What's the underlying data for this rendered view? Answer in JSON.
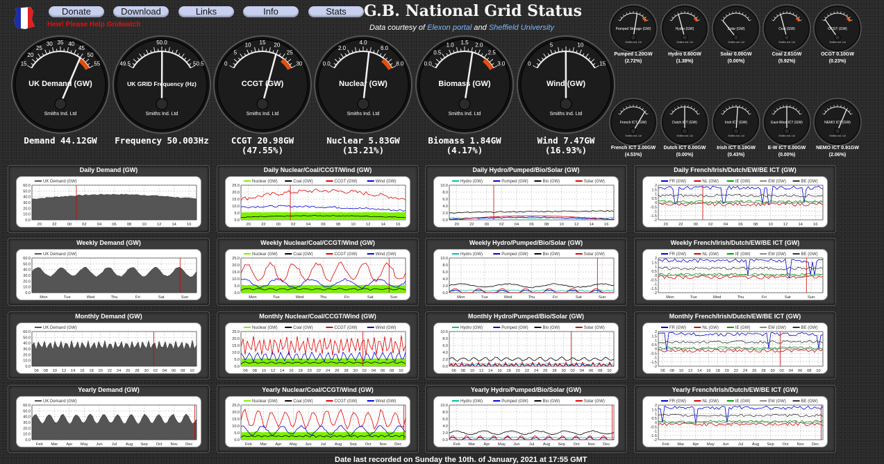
{
  "nav": [
    "Donate",
    "Download",
    "Links",
    "Info",
    "Stats"
  ],
  "help_text": "Hew! Please Help Gridwatch",
  "site_title": "G.B. National Grid Status",
  "credit": {
    "prefix": "Data courtesy of ",
    "elexon": "Elexon portal",
    "mid": " and ",
    "sheffield": "Sheffield University"
  },
  "gauge_brand": "Smiths Ind. Ltd",
  "colors": {
    "nuclear": "#7ef000",
    "coal": "#000000",
    "ccgt": "#e00000",
    "wind": "#0000e0",
    "hydro": "#00c0a0",
    "pumped": "#0000e0",
    "bio": "#000000",
    "solar": "#e00000",
    "fr": "#0000d0",
    "nl": "#d00000",
    "ie": "#00a000",
    "ew": "#888888",
    "be": "#333333",
    "demand_fill": "#555555",
    "marker": "#d00000"
  },
  "big_gauges": [
    {
      "label": "UK Demand (GW)",
      "min": 0,
      "max": 55,
      "ticks": [
        "15",
        "20",
        "25",
        "30",
        "35",
        "40",
        "45",
        "50",
        "55"
      ],
      "value": 44.12,
      "caption1": "Demand 44.12GW",
      "caption2": "",
      "redzone": true
    },
    {
      "label": "UK GRID Frequency (Hz)",
      "min": 49.5,
      "max": 50.5,
      "ticks": [
        "49.5",
        "50.0",
        "50.5"
      ],
      "value": 50.003,
      "caption1": "Frequency 50.003Hz",
      "caption2": "",
      "redzone": false
    },
    {
      "label": "CCGT (GW)",
      "min": 0,
      "max": 30,
      "ticks": [
        "0",
        "5",
        "10",
        "15",
        "20",
        "25",
        "30"
      ],
      "value": 20.98,
      "caption1": "CCGT 20.98GW",
      "caption2": "(47.55%)",
      "redzone": true
    },
    {
      "label": "Nuclear (GW)",
      "min": 0,
      "max": 10,
      "ticks": [
        "0.0",
        "2.0",
        "4.0",
        "6.0",
        "8.0"
      ],
      "value": 5.83,
      "caption1": "Nuclear 5.83GW",
      "caption2": "(13.21%)",
      "redzone": true
    },
    {
      "label": "Biomass (GW)",
      "min": 0,
      "max": 3,
      "ticks": [
        "0.0",
        "0.5",
        "1.0",
        "1.5",
        "2.0",
        "2.5",
        "3.0"
      ],
      "value": 1.84,
      "caption1": "Biomass 1.84GW",
      "caption2": "(4.17%)",
      "redzone": true
    },
    {
      "label": "Wind (GW)",
      "min": 0,
      "max": 15,
      "ticks": [
        "0",
        "5",
        "10",
        "15"
      ],
      "value": 7.47,
      "caption1": "Wind 7.47GW",
      "caption2": "(16.93%)",
      "redzone": false
    }
  ],
  "small_gauges": [
    {
      "label": "Pumped Storage (GW)",
      "value_frac": 0.62,
      "caption1": "Pumped 1.20GW",
      "caption2": "(2.72%)"
    },
    {
      "label": "Hydro (GW)",
      "value_frac": 0.3,
      "caption1": "Hydro 0.60GW",
      "caption2": "(1.38%)"
    },
    {
      "label": "Solar (GW)",
      "value_frac": 0.0,
      "caption1": "Solar 0.00GW",
      "caption2": "(0.00%)"
    },
    {
      "label": "Coal (GW)",
      "value_frac": 0.3,
      "caption1": "Coal 2.61GW",
      "caption2": "(5.92%)"
    },
    {
      "label": "OCGT (GW)",
      "value_frac": 0.05,
      "caption1": "OCGT 0.10GW",
      "caption2": "(0.23%)"
    },
    {
      "label": "French ICT (GW)",
      "value_frac": 0.9,
      "caption1": "French ICT 2.00GW",
      "caption2": "(4.53%)"
    },
    {
      "label": "Dutch ICT (GW)",
      "value_frac": 0.5,
      "caption1": "Dutch ICT 0.00GW",
      "caption2": "(0.00%)"
    },
    {
      "label": "Irish ICT (GW)",
      "value_frac": 0.55,
      "caption1": "Irish ICT 0.19GW",
      "caption2": "(0.43%)"
    },
    {
      "label": "East-West ICT (GW)",
      "value_frac": 0.5,
      "caption1": "E-W ICT 0.00GW",
      "caption2": "(0.00%)"
    },
    {
      "label": "NEMO ICT (GW)",
      "value_frac": 0.8,
      "caption1": "NEMO ICT 0.91GW",
      "caption2": "(2.06%)"
    }
  ],
  "chart_data": [
    {
      "id": "daily-demand",
      "title": "Daily Demand (GW)",
      "type": "area",
      "kind": "demand",
      "ylim": [
        0,
        60
      ],
      "yticks": [
        "0.0",
        "10.0",
        "20.0",
        "30.0",
        "40.0",
        "50.0",
        "60.0"
      ],
      "xlabels": [
        "20",
        "22",
        "00",
        "02",
        "04",
        "06",
        "08",
        "10",
        "12",
        "14",
        "16"
      ],
      "legend": [
        "UK Demand (GW)"
      ],
      "marker": 0.27
    },
    {
      "id": "daily-gen",
      "title": "Daily Nuclear/Coal/CCGT/Wind (GW)",
      "type": "line",
      "kind": "gen",
      "ylim": [
        0,
        25
      ],
      "yticks": [
        "0.0",
        "5.0",
        "10.0",
        "15.0",
        "20.0",
        "25.0"
      ],
      "xlabels": [
        "20",
        "22",
        "00",
        "02",
        "04",
        "06",
        "08",
        "10",
        "12",
        "14",
        "16"
      ],
      "legend": [
        "Nuclear (GW)",
        "Coal (GW)",
        "CCGT (GW)",
        "Wind (GW)"
      ],
      "marker": 0.3
    },
    {
      "id": "daily-hydro",
      "title": "Daily Hydro/Pumped/Bio/Solar (GW)",
      "type": "line",
      "kind": "hydro",
      "ylim": [
        0,
        10
      ],
      "yticks": [
        "0.0",
        "2.0",
        "4.0",
        "6.0",
        "8.0",
        "10.0"
      ],
      "xlabels": [
        "20",
        "22",
        "00",
        "02",
        "04",
        "06",
        "08",
        "10",
        "12",
        "14",
        "16"
      ],
      "legend": [
        "Hydro (GW)",
        "Pumped (GW)",
        "Bio (GW)",
        "Solar (GW)"
      ],
      "marker": 0.27
    },
    {
      "id": "daily-ict",
      "title": "Daily French/Irish/Dutch/EW/BE ICT (GW)",
      "type": "line",
      "kind": "ict",
      "ylim": [
        -2,
        2
      ],
      "yticks": [
        "-2",
        "-1.5",
        "-1",
        "-0.5",
        "0",
        "0.5",
        "1",
        "1.5",
        "2"
      ],
      "xlabels": [
        "20",
        "22",
        "00",
        "02",
        "04",
        "06",
        "08",
        "10",
        "12",
        "14",
        "16"
      ],
      "legend": [
        "FR (GW)",
        "NL (GW)",
        "IE (GW)",
        "EW (GW)",
        "BE (GW)"
      ],
      "marker": 0.27
    },
    {
      "id": "weekly-demand",
      "title": "Weekly Demand (GW)",
      "type": "area",
      "kind": "demand",
      "ylim": [
        0,
        60
      ],
      "yticks": [
        "0.0",
        "10.0",
        "20.0",
        "30.0",
        "40.0",
        "50.0",
        "60.0"
      ],
      "xlabels": [
        "Mon",
        "Tue",
        "Wed",
        "Thu",
        "Fri",
        "Sat",
        "Sun"
      ],
      "legend": [
        "UK Demand (GW)"
      ],
      "marker": 0.9
    },
    {
      "id": "weekly-gen",
      "title": "Weekly Nuclear/Coal/CCGT/Wind (GW)",
      "type": "line",
      "kind": "gen",
      "ylim": [
        0,
        25
      ],
      "yticks": [
        "0.0",
        "5.0",
        "10.0",
        "15.0",
        "20.0",
        "25.0"
      ],
      "xlabels": [
        "Mon",
        "Tue",
        "Wed",
        "Thu",
        "Fri",
        "Sat",
        "Sun"
      ],
      "legend": [
        "Nuclear (GW)",
        "Coal (GW)",
        "CCGT (GW)",
        "Wind (GW)"
      ],
      "marker": 0.9
    },
    {
      "id": "weekly-hydro",
      "title": "Weekly Hydro/Pumped/Bio/Solar (GW)",
      "type": "line",
      "kind": "hydro",
      "ylim": [
        0,
        10
      ],
      "yticks": [
        "0.0",
        "2.0",
        "4.0",
        "6.0",
        "8.0",
        "10.0"
      ],
      "xlabels": [
        "Mon",
        "Tue",
        "Wed",
        "Thu",
        "Fri",
        "Sat",
        "Sun"
      ],
      "legend": [
        "Hydro (GW)",
        "Pumped (GW)",
        "Bio (GW)",
        "Solar (GW)"
      ],
      "marker": 0.9
    },
    {
      "id": "weekly-ict",
      "title": "Weekly French/Irish/Dutch/EW/BE ICT (GW)",
      "type": "line",
      "kind": "ict",
      "ylim": [
        -2,
        2
      ],
      "yticks": [
        "-2",
        "-1.5",
        "-1",
        "-0.5",
        "0",
        "0.5",
        "1",
        "1.5",
        "2"
      ],
      "xlabels": [
        "Mon",
        "Tue",
        "Wed",
        "Thu",
        "Fri",
        "Sat",
        "Sun"
      ],
      "legend": [
        "FR (GW)",
        "NL (GW)",
        "IE (GW)",
        "EW (GW)",
        "BE (GW)"
      ],
      "marker": 0.9
    },
    {
      "id": "monthly-demand",
      "title": "Monthly Demand (GW)",
      "type": "area",
      "kind": "demand",
      "ylim": [
        0,
        60
      ],
      "yticks": [
        "0.0",
        "10.0",
        "20.0",
        "30.0",
        "40.0",
        "50.0",
        "60.0"
      ],
      "xlabels": [
        "06",
        "08",
        "10",
        "12",
        "14",
        "16",
        "18",
        "20",
        "22",
        "24",
        "26",
        "28",
        "30",
        "02",
        "04",
        "06",
        "08",
        "10"
      ],
      "legend": [
        "UK Demand (GW)"
      ],
      "marker": 0.74
    },
    {
      "id": "monthly-gen",
      "title": "Monthly Nuclear/Coal/CCGT/Wind (GW)",
      "type": "line",
      "kind": "gen",
      "ylim": [
        0,
        25
      ],
      "yticks": [
        "0.0",
        "5.0",
        "10.0",
        "15.0",
        "20.0",
        "25.0"
      ],
      "xlabels": [
        "06",
        "08",
        "10",
        "12",
        "14",
        "16",
        "18",
        "20",
        "22",
        "24",
        "26",
        "28",
        "30",
        "02",
        "04",
        "06",
        "08",
        "10"
      ],
      "legend": [
        "Nuclear (GW)",
        "Coal (GW)",
        "CCGT (GW)",
        "Wind (GW)"
      ],
      "marker": 0.74
    },
    {
      "id": "monthly-hydro",
      "title": "Monthly Hydro/Pumped/Bio/Solar (GW)",
      "type": "line",
      "kind": "hydro",
      "ylim": [
        0,
        10
      ],
      "yticks": [
        "0.0",
        "2.0",
        "4.0",
        "6.0",
        "8.0",
        "10.0"
      ],
      "xlabels": [
        "06",
        "08",
        "10",
        "12",
        "14",
        "16",
        "18",
        "20",
        "22",
        "24",
        "26",
        "28",
        "30",
        "02",
        "04",
        "06",
        "08",
        "10"
      ],
      "legend": [
        "Hydro (GW)",
        "Pumped (GW)",
        "Bio (GW)",
        "Solar (GW)"
      ],
      "marker": 0.74
    },
    {
      "id": "monthly-ict",
      "title": "Monthly French/Irish/Dutch/EW/BE ICT (GW)",
      "type": "line",
      "kind": "ict",
      "ylim": [
        -2,
        2
      ],
      "yticks": [
        "-2",
        "-1.5",
        "-1",
        "-0.5",
        "0",
        "0.5",
        "1",
        "1.5",
        "2"
      ],
      "xlabels": [
        "06",
        "08",
        "10",
        "12",
        "14",
        "16",
        "18",
        "20",
        "22",
        "24",
        "26",
        "28",
        "30",
        "02",
        "04",
        "06",
        "08",
        "10"
      ],
      "legend": [
        "FR (GW)",
        "NL (GW)",
        "IE (GW)",
        "EW (GW)",
        "BE (GW)"
      ],
      "marker": 0.74
    },
    {
      "id": "yearly-demand",
      "title": "Yearly Demand (GW)",
      "type": "area",
      "kind": "demand",
      "ylim": [
        0,
        60
      ],
      "yticks": [
        "0.0",
        "10.0",
        "20.0",
        "30.0",
        "40.0",
        "50.0",
        "60.0"
      ],
      "xlabels": [
        "Feb",
        "Mar",
        "Apr",
        "May",
        "Jun",
        "Jul",
        "Aug",
        "Sep",
        "Oct",
        "Nov",
        "Dec"
      ],
      "legend": [
        "UK Demand (GW)"
      ],
      "marker": 0.99
    },
    {
      "id": "yearly-gen",
      "title": "Yearly Nuclear/Coal/CCGT/Wind (GW)",
      "type": "line",
      "kind": "gen",
      "ylim": [
        0,
        25
      ],
      "yticks": [
        "0.0",
        "5.0",
        "10.0",
        "15.0",
        "20.0",
        "25.0"
      ],
      "xlabels": [
        "Feb",
        "Mar",
        "Apr",
        "May",
        "Jun",
        "Jul",
        "Aug",
        "Sep",
        "Oct",
        "Nov",
        "Dec"
      ],
      "legend": [
        "Nuclear (GW)",
        "Coal (GW)",
        "CCGT (GW)",
        "Wind (GW)"
      ],
      "marker": 0.99
    },
    {
      "id": "yearly-hydro",
      "title": "Yearly Hydro/Pumped/Bio/Solar (GW)",
      "type": "line",
      "kind": "hydro",
      "ylim": [
        0,
        10
      ],
      "yticks": [
        "0.0",
        "2.0",
        "4.0",
        "6.0",
        "8.0",
        "10.0"
      ],
      "xlabels": [
        "Feb",
        "Mar",
        "Apr",
        "May",
        "Jun",
        "Jul",
        "Aug",
        "Sep",
        "Oct",
        "Nov",
        "Dec"
      ],
      "legend": [
        "Hydro (GW)",
        "Pumped (GW)",
        "Bio (GW)",
        "Solar (GW)"
      ],
      "marker": 0.99
    },
    {
      "id": "yearly-ict",
      "title": "Yearly French/Irish/Dutch/EW/BE ICT (GW)",
      "type": "line",
      "kind": "ict",
      "ylim": [
        -2,
        2
      ],
      "yticks": [
        "-2",
        "-1.5",
        "-1",
        "-0.5",
        "0",
        "0.5",
        "1",
        "1.5",
        "2"
      ],
      "xlabels": [
        "Feb",
        "Mar",
        "Apr",
        "May",
        "Jun",
        "Jul",
        "Aug",
        "Sep",
        "Oct",
        "Nov",
        "Dec"
      ],
      "legend": [
        "FR (GW)",
        "NL (GW)",
        "IE (GW)",
        "EW (GW)",
        "BE (GW)"
      ],
      "marker": 0.99
    }
  ],
  "footer": "Date last recorded on Sunday the 10th. of January, 2021 at 17:55 GMT"
}
